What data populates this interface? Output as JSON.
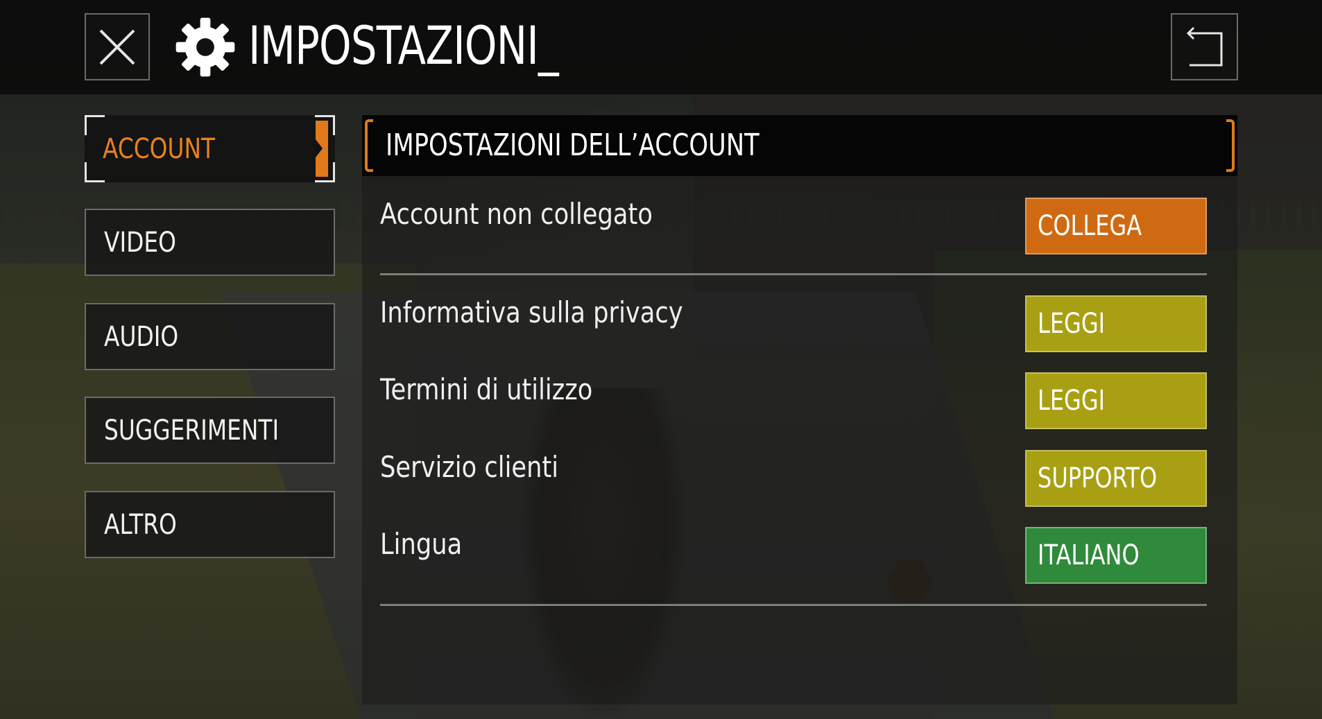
{
  "header": {
    "title": "IMPOSTAZIONI_",
    "close_icon": "close-icon",
    "settings_icon": "gear-icon",
    "back_icon": "back-arrow-icon"
  },
  "sidebar": {
    "items": [
      {
        "label": "ACCOUNT",
        "active": true
      },
      {
        "label": "VIDEO",
        "active": false
      },
      {
        "label": "AUDIO",
        "active": false
      },
      {
        "label": "SUGGERIMENTI",
        "active": false
      },
      {
        "label": "ALTRO",
        "active": false
      }
    ]
  },
  "panel": {
    "title": "IMPOSTAZIONI DELL’ACCOUNT",
    "rows": [
      {
        "label": "Account non collegato",
        "button": "COLLEGA",
        "color": "#cf6a12"
      },
      {
        "label": "Informativa sulla privacy",
        "button": "LEGGI",
        "color": "#a8a012"
      },
      {
        "label": "Termini di utilizzo",
        "button": "LEGGI",
        "color": "#a8a012"
      },
      {
        "label": "Servizio clienti",
        "button": "SUPPORTO",
        "color": "#a8a012"
      },
      {
        "label": "Lingua",
        "button": "ITALIANO",
        "color": "#2f8a3b"
      }
    ]
  },
  "colors": {
    "accent": "#e07a1c",
    "collega": "#cf6a12",
    "leggi": "#a8a012",
    "italiano": "#2f8a3b"
  }
}
